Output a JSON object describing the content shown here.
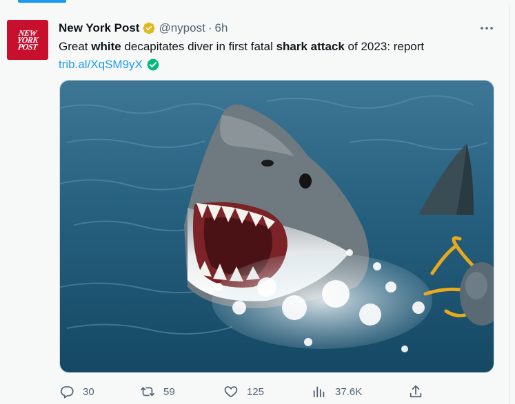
{
  "tweet": {
    "author_name": "New York Post",
    "handle": "@nypost",
    "separator": "·",
    "time": "6h",
    "text_parts": [
      {
        "text": "Great ",
        "bold": false
      },
      {
        "text": "white",
        "bold": true
      },
      {
        "text": " decapitates diver in first fatal ",
        "bold": false
      },
      {
        "text": "shark attack",
        "bold": true
      },
      {
        "text": " of 2023: report",
        "bold": false
      }
    ],
    "link": "trib.al/XqSM9yX",
    "avatar_logo": [
      "NEW",
      "YORK",
      "POST"
    ]
  },
  "actions": {
    "replies": "30",
    "retweets": "59",
    "likes": "125",
    "views": "37.6K"
  },
  "icons": {
    "verified": "verified-gold-badge-icon",
    "link_check": "check-circle-icon",
    "more": "more-horizontal-icon",
    "reply": "reply-icon",
    "retweet": "retweet-icon",
    "like": "heart-icon",
    "views": "analytics-icon",
    "share": "share-icon"
  },
  "colors": {
    "accent": "#1d9bf0",
    "verified_gold": "#e2b719",
    "link_check_green": "#00ba7c",
    "avatar_red": "#c8102e",
    "muted": "#536471"
  }
}
